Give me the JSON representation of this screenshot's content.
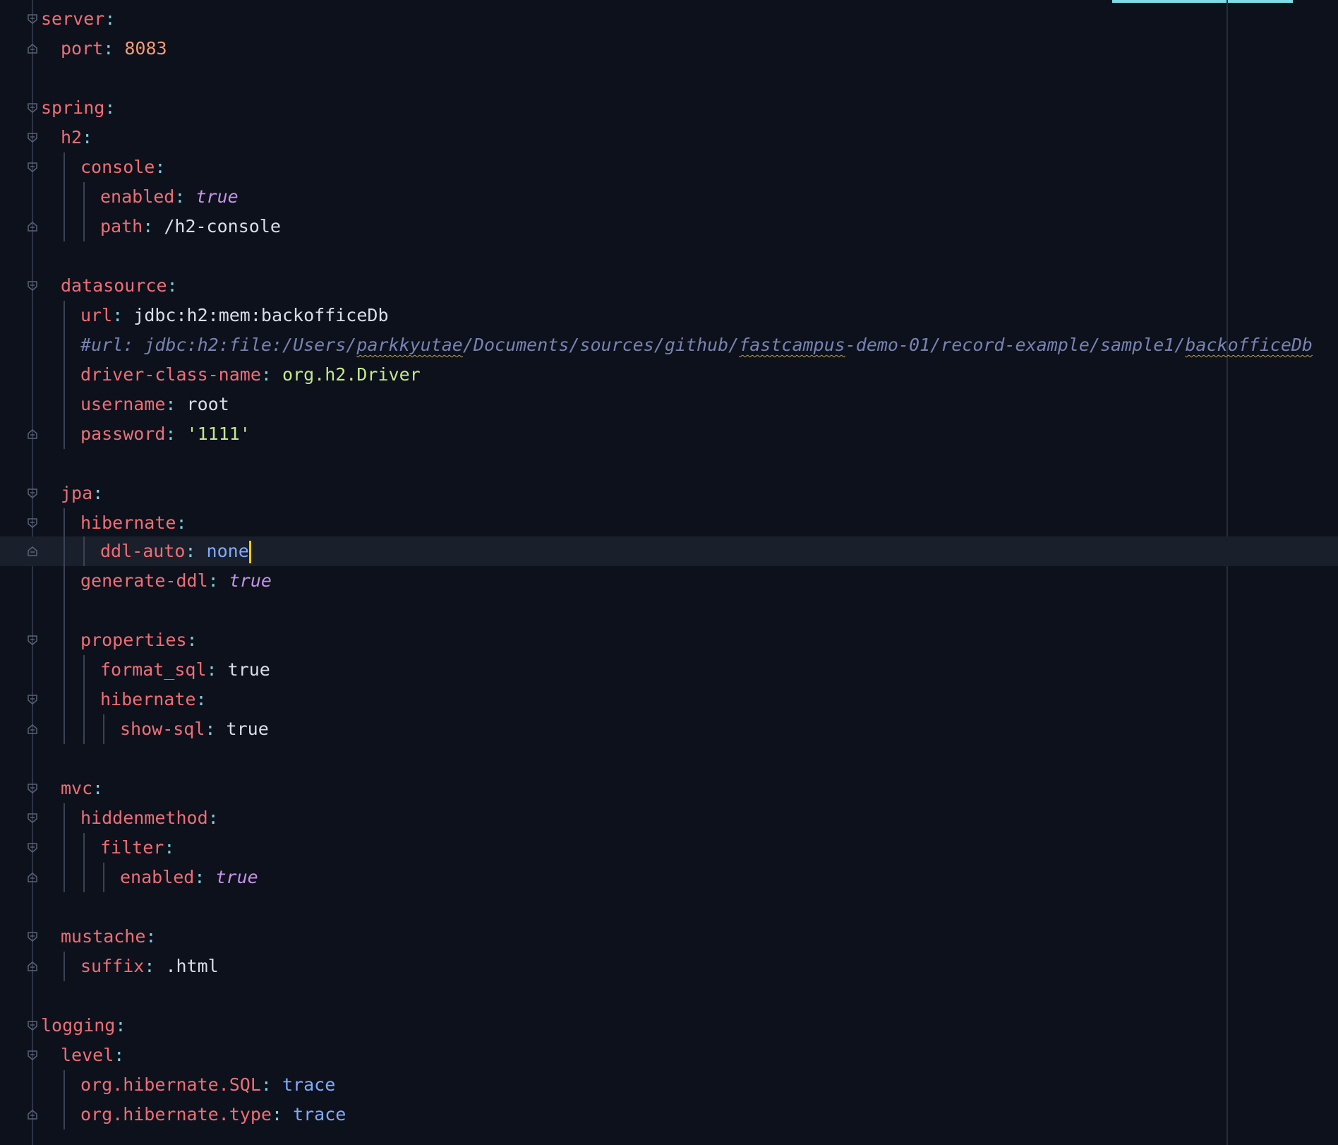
{
  "editor": {
    "language": "yaml",
    "lines": {
      "server": "server",
      "port_key": "port",
      "port_val": "8083",
      "spring": "spring",
      "h2": "h2",
      "console": "console",
      "enabled1_key": "enabled",
      "enabled1_val": "true",
      "path_key": "path",
      "path_val": "/h2-console",
      "datasource": "datasource",
      "url_key": "url",
      "url_val": "jdbc:h2:mem:backofficeDb",
      "comment_a": "#url: jdbc:h2:file:/Users/",
      "comment_b": "parkkyutae",
      "comment_c": "/Documents/sources/github/",
      "comment_d": "fastcampus",
      "comment_e": "-demo-01/record-example/sample1/",
      "comment_f": "backofficeDb",
      "driver_key": "driver-class-name",
      "driver_val": "org.h2.Driver",
      "username_key": "username",
      "username_val": "root",
      "password_key": "password",
      "password_val": "'1111'",
      "jpa": "jpa",
      "hibernate1": "hibernate",
      "ddl_key": "ddl-auto",
      "ddl_val": "none",
      "genddl_key": "generate-ddl",
      "genddl_val": "true",
      "properties": "properties",
      "formatsql_key": "format_sql",
      "formatsql_val": "true",
      "hibernate2": "hibernate",
      "showsql_key": "show-sql",
      "showsql_val": "true",
      "mvc": "mvc",
      "hiddenmethod": "hiddenmethod",
      "filter": "filter",
      "enabled2_key": "enabled",
      "enabled2_val": "true",
      "mustache": "mustache",
      "suffix_key": "suffix",
      "suffix_val": ".html",
      "logging": "logging",
      "level": "level",
      "sql_key": "org.hibernate.SQL",
      "sql_val": "trace",
      "type_key": "org.hibernate.type",
      "type_val": "trace",
      "colon": ":"
    }
  },
  "colors": {
    "background": "#0d111b",
    "key": "#ee6e77",
    "number": "#f39b74",
    "boolean": "#c792ea",
    "string_green": "#c3e88d",
    "enum_blue": "#82aaff",
    "comment": "#7883b4",
    "caret": "#ffcc00"
  }
}
